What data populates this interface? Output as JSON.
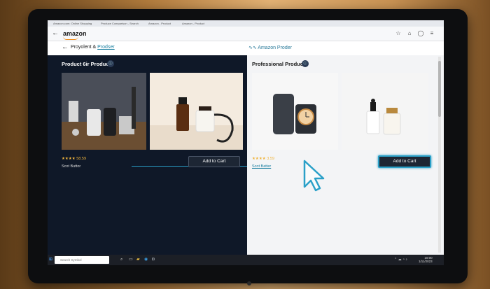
{
  "browser": {
    "tabs": [
      "Amazon.com: Online Shopping",
      "Produce Comparison - Search",
      "Amazon - Product",
      "Amazon - Product"
    ],
    "logo": "amazon"
  },
  "subbar": {
    "left_text": "Proyolent",
    "left_sep": "&",
    "left_link": "Prodser",
    "right_text": "Amazon Proder"
  },
  "left": {
    "title": "Product 6ir Product",
    "rating": "★★★★ 58.59",
    "subtext": "Scot Buttor",
    "cart": "Add to Cart"
  },
  "right": {
    "title": "Professional Product",
    "rating": "★★★★ 3.59",
    "subtext": "Scot Batter",
    "cart": "Add to Cart"
  },
  "taskbar": {
    "search_placeholder": "Search Symbol",
    "time": "10:00",
    "date": "1/11/2023"
  },
  "colors": {
    "accent": "#2aa0c8",
    "dark_pane": "#0f1828",
    "cart": "#1d2634"
  }
}
